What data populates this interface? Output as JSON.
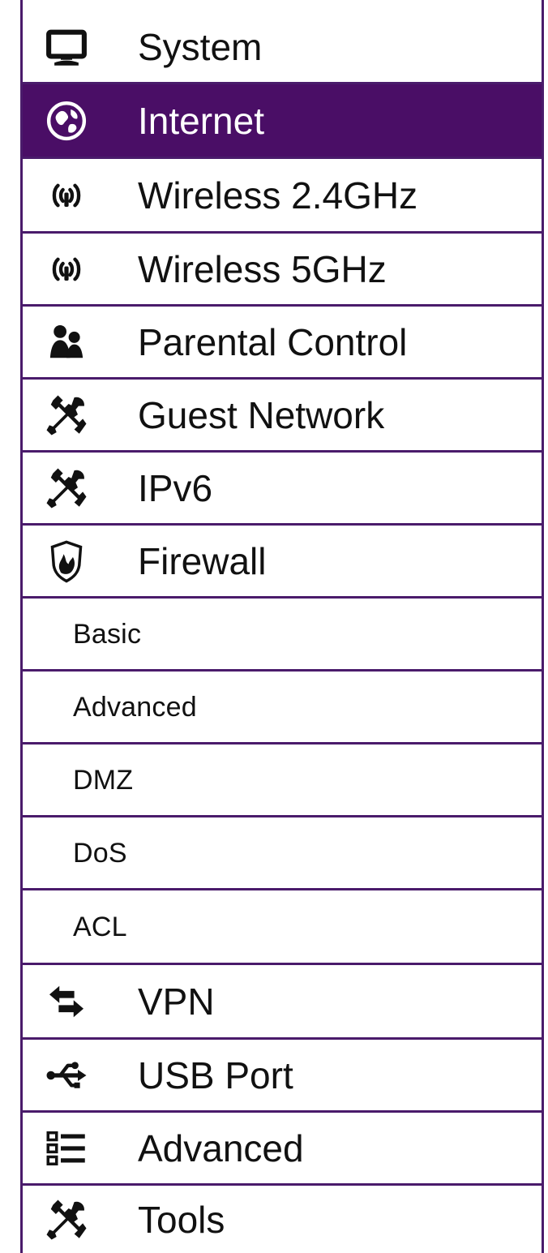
{
  "colors": {
    "accent": "#4a0e66",
    "border": "#4a1b6b",
    "text": "#111111",
    "active_text": "#ffffff"
  },
  "menu": {
    "items": [
      {
        "label": "System",
        "icon": "monitor-icon",
        "active": false
      },
      {
        "label": "Internet",
        "icon": "globe-icon",
        "active": true
      },
      {
        "label": "Wireless 2.4GHz",
        "icon": "wireless-icon",
        "active": false
      },
      {
        "label": "Wireless 5GHz",
        "icon": "wireless-icon",
        "active": false
      },
      {
        "label": "Parental Control",
        "icon": "users-icon",
        "active": false
      },
      {
        "label": "Guest Network",
        "icon": "tools-icon",
        "active": false
      },
      {
        "label": "IPv6",
        "icon": "tools-icon",
        "active": false
      },
      {
        "label": "Firewall",
        "icon": "shield-fire-icon",
        "active": false
      },
      {
        "label": "Basic",
        "sub": true
      },
      {
        "label": "Advanced",
        "sub": true
      },
      {
        "label": "DMZ",
        "sub": true
      },
      {
        "label": "DoS",
        "sub": true
      },
      {
        "label": "ACL",
        "sub": true
      },
      {
        "label": "VPN",
        "icon": "swap-arrows-icon",
        "active": false
      },
      {
        "label": "USB Port",
        "icon": "usb-icon",
        "active": false
      },
      {
        "label": "Advanced",
        "icon": "list-icon",
        "active": false
      },
      {
        "label": "Tools",
        "icon": "tools-icon",
        "active": false
      }
    ]
  }
}
